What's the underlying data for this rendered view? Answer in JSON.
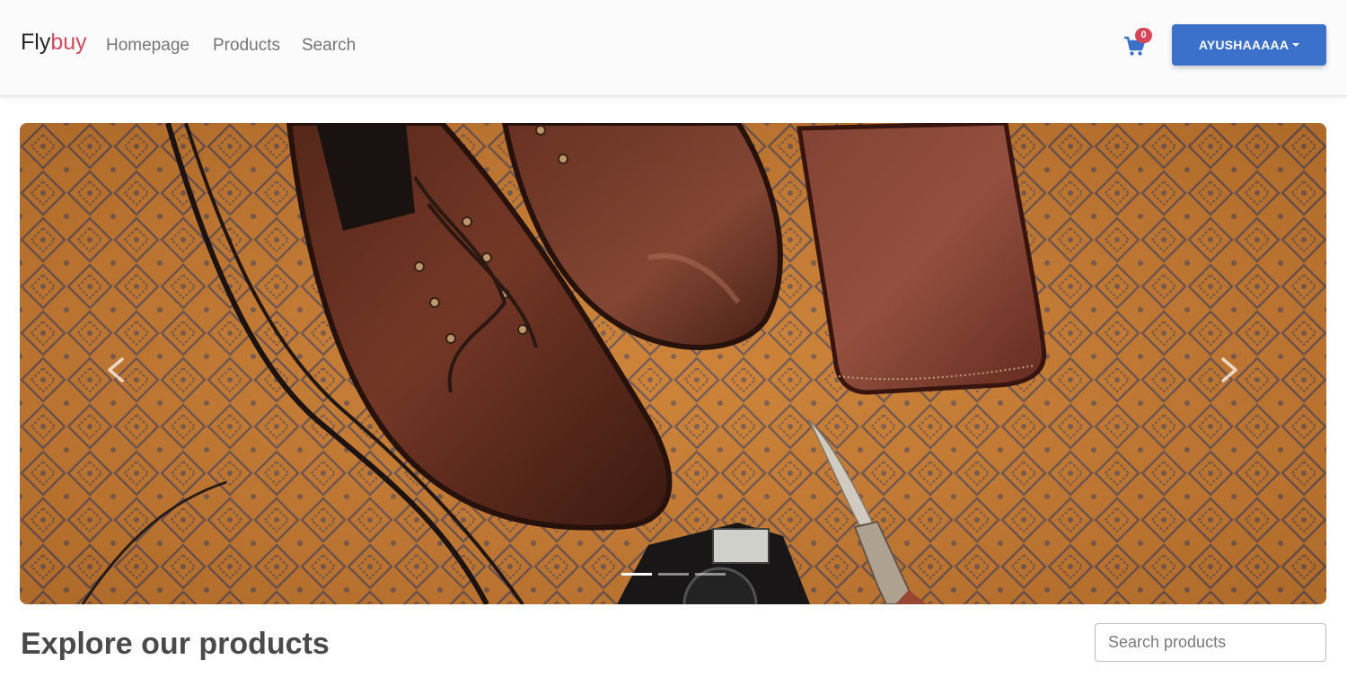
{
  "navbar": {
    "brand_part1": "Fly",
    "brand_part2": "buy",
    "links": [
      "Homepage",
      "Products",
      "Search"
    ],
    "cart_icon": "shopping-cart-icon",
    "cart_count": "0",
    "user_label": "AYUSHAAAAA"
  },
  "carousel": {
    "prev_icon": "chevron-left-icon",
    "next_icon": "chevron-right-icon",
    "slide_count": 3,
    "active_slide": 1
  },
  "main": {
    "section_title": "Explore our products",
    "search_placeholder": "Search products"
  },
  "colors": {
    "accent": "#3b71ca",
    "brand_red": "#d04c5c",
    "badge": "#d64558"
  }
}
